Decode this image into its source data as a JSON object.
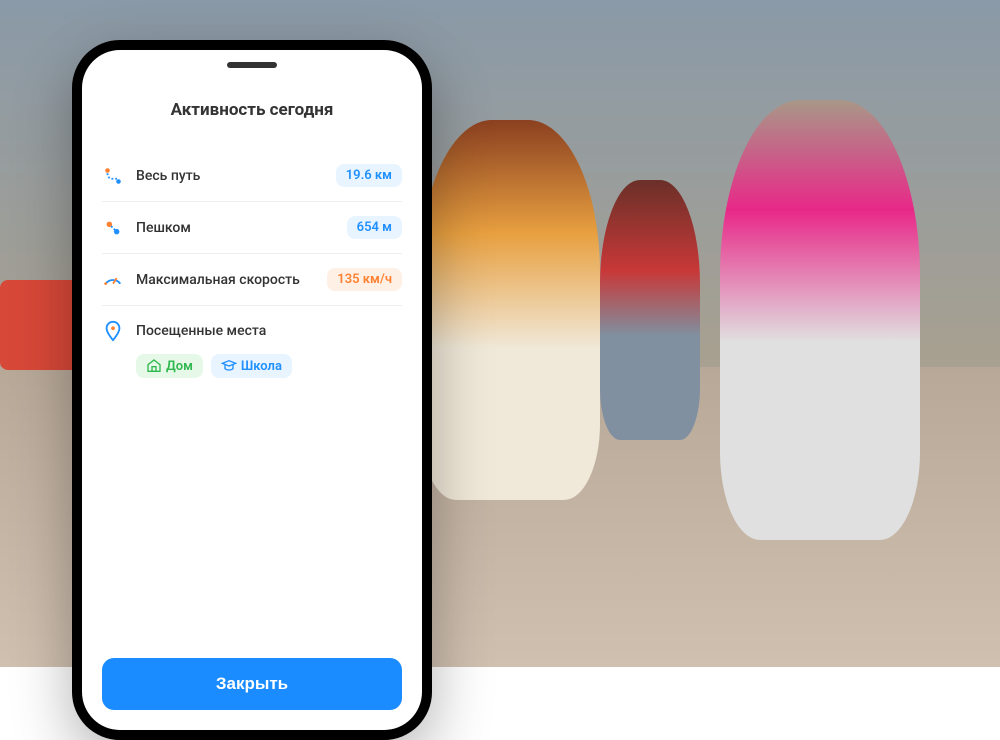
{
  "app": {
    "title": "Активность сегодня",
    "stats": [
      {
        "icon": "route",
        "label": "Весь путь",
        "value": "19.6 км",
        "color": "blue"
      },
      {
        "icon": "walk",
        "label": "Пешком",
        "value": "654 м",
        "color": "blue"
      },
      {
        "icon": "speed",
        "label": "Максимальная скорость",
        "value": "135 км/ч",
        "color": "orange"
      }
    ],
    "places": {
      "label": "Посещенные места",
      "tags": [
        {
          "icon": "home",
          "label": "Дом",
          "color": "green"
        },
        {
          "icon": "school",
          "label": "Школа",
          "color": "blue"
        }
      ]
    },
    "close_button": "Закрыть"
  }
}
